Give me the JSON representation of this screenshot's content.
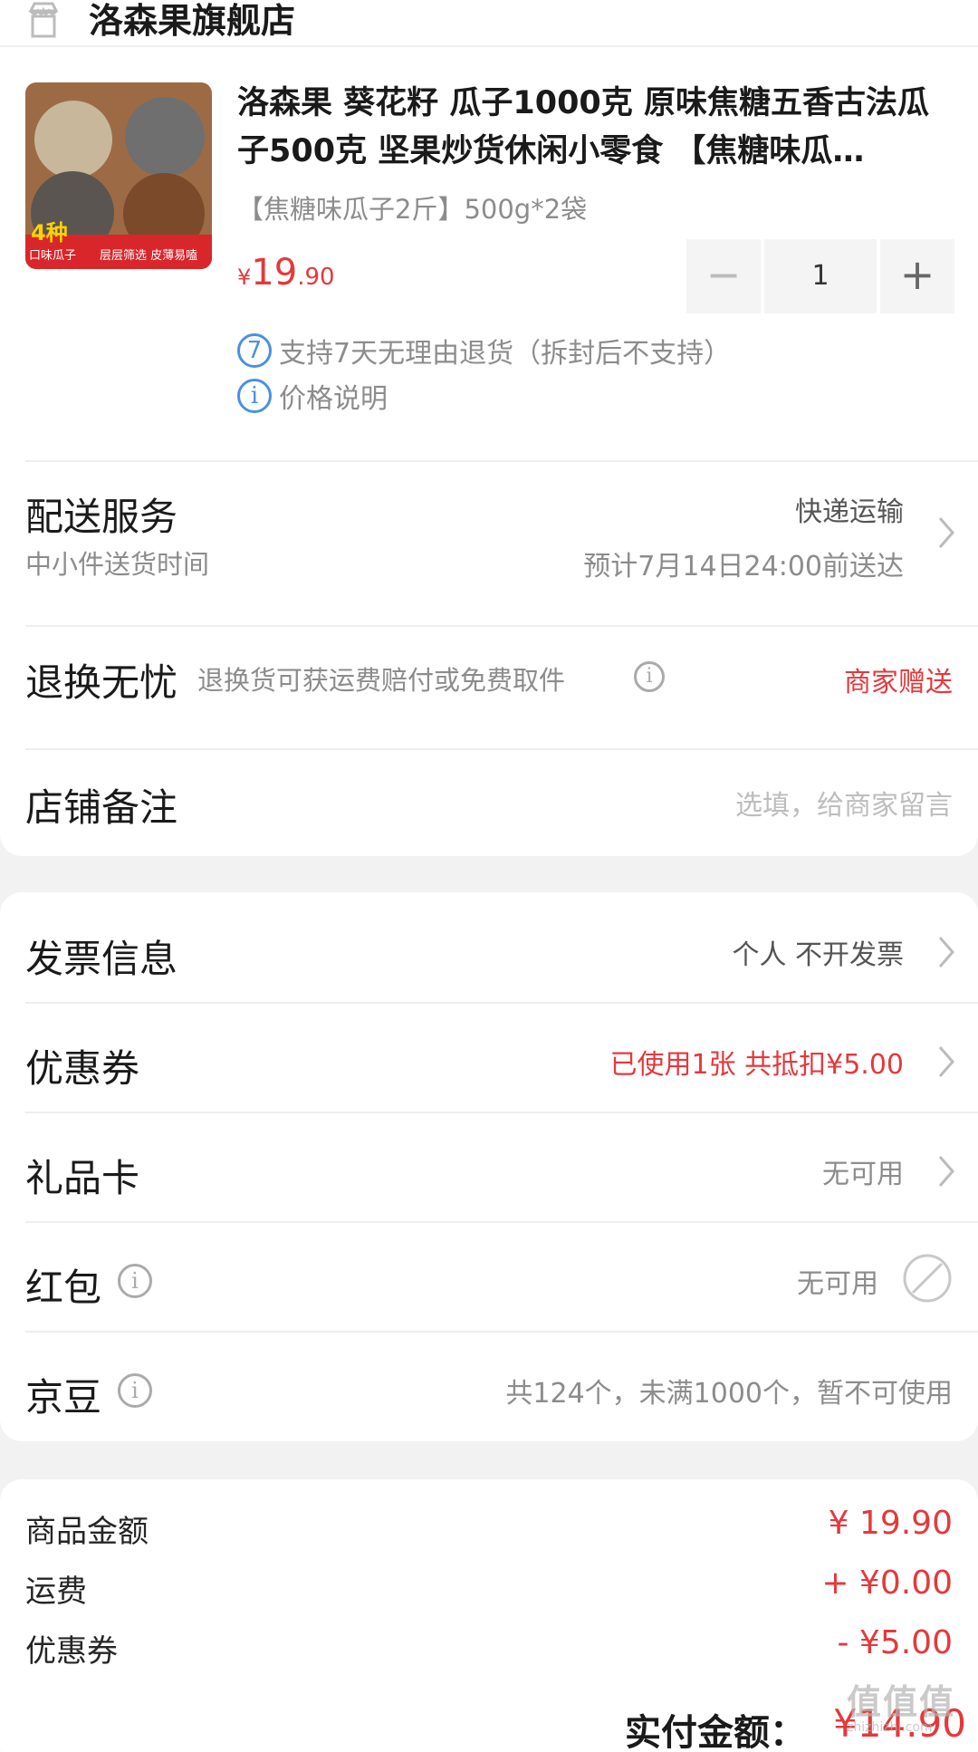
{
  "store": {
    "name": "洛森果旗舰店",
    "icon": "store-icon"
  },
  "product": {
    "title": "洛森果 葵花籽 瓜子1000克 原味焦糖五香古法瓜子500克 坚果炒货休闲小零食 【焦糖味瓜…",
    "spec": "【焦糖味瓜子2斤】500g*2袋",
    "price_currency": "¥",
    "price_int": "19",
    "price_dec": ".90",
    "thumb_tag_big": "4种",
    "thumb_tag_line1": "口味瓜子",
    "thumb_tag_line2": "层层筛选 皮薄易嗑",
    "quantity": "1",
    "minus": "−",
    "plus": "+",
    "return_badge": "7",
    "return_policy": "支持7天无理由退货（拆封后不支持）",
    "price_info_icon": "i",
    "price_info": "价格说明"
  },
  "delivery": {
    "title": "配送服务",
    "method": "快递运输",
    "sub": "中小件送货时间",
    "eta": "预计7月14日24:00前送达"
  },
  "return_service": {
    "title": "退换无忧",
    "desc": "退换货可获运费赔付或免费取件",
    "value": "商家赠送"
  },
  "note": {
    "title": "店铺备注",
    "placeholder": "选填，给商家留言"
  },
  "invoice": {
    "title": "发票信息",
    "value": "个人 不开发票"
  },
  "coupon": {
    "title": "优惠券",
    "value": "已使用1张 共抵扣¥5.00"
  },
  "gift_card": {
    "title": "礼品卡",
    "value": "无可用"
  },
  "red_packet": {
    "title": "红包",
    "value": "无可用"
  },
  "jd_beans": {
    "title": "京豆",
    "value": "共124个，未满1000个，暂不可使用"
  },
  "summary": {
    "goods_label": "商品金额",
    "goods_value": "¥ 19.90",
    "shipping_label": "运费",
    "shipping_value": "+ ¥0.00",
    "coupon_label": "优惠券",
    "coupon_value": "- ¥5.00",
    "pay_label": "实付金额：",
    "pay_value": "¥14.90"
  },
  "watermark": {
    "text": "值值值",
    "sub": "zhizhizhi.com"
  },
  "colors": {
    "accent": "#e4393c",
    "blue": "#4a90e2",
    "muted": "#8c8c8c"
  }
}
